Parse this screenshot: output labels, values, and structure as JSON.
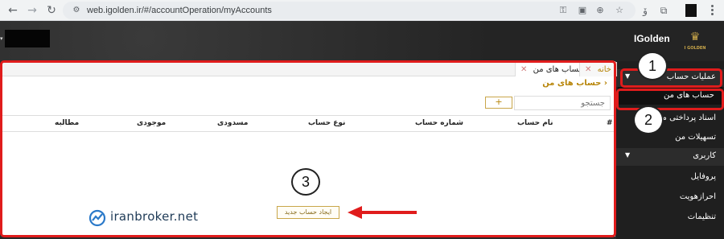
{
  "browser": {
    "url": "web.igolden.ir/#/accountOperation/myAccounts",
    "icons": [
      "back-arrow-icon",
      "forward-arrow-icon",
      "reload-icon",
      "site-info-icon",
      "password-key-icon",
      "install-app-icon",
      "zoom-icon",
      "bookmark-star-icon",
      "translate-icon",
      "extensions-icon",
      "menu-kebab-icon"
    ]
  },
  "header": {
    "brand_name": "IGolden",
    "logo_text": "I GOLDEN"
  },
  "sidebar": {
    "groups": [
      {
        "label": "عملیات حساب"
      },
      {
        "label": "کاربری"
      }
    ],
    "items": [
      {
        "label": "حساب های من"
      },
      {
        "label": "اسناد پرداختی من"
      },
      {
        "label": "تسهیلات من"
      },
      {
        "label": "پروفایل"
      },
      {
        "label": "احرازهویت"
      },
      {
        "label": "تنظیمات"
      }
    ]
  },
  "tabs": [
    {
      "label": "حساب های من"
    },
    {
      "label": "خانه"
    }
  ],
  "main": {
    "breadcrumb": "حساب های من",
    "search_placeholder": "جستجو",
    "add_label": "+",
    "columns": [
      "#",
      "نام حساب",
      "شماره حساب",
      "نوع حساب",
      "مسدودی",
      "موجودی",
      "مطالبه"
    ],
    "create_button": "ایجاد حساب جدید"
  },
  "watermark": {
    "text": "iranbroker.net"
  },
  "annotations": {
    "badges": [
      "1",
      "2",
      "3"
    ],
    "color": "#e01c1c"
  }
}
